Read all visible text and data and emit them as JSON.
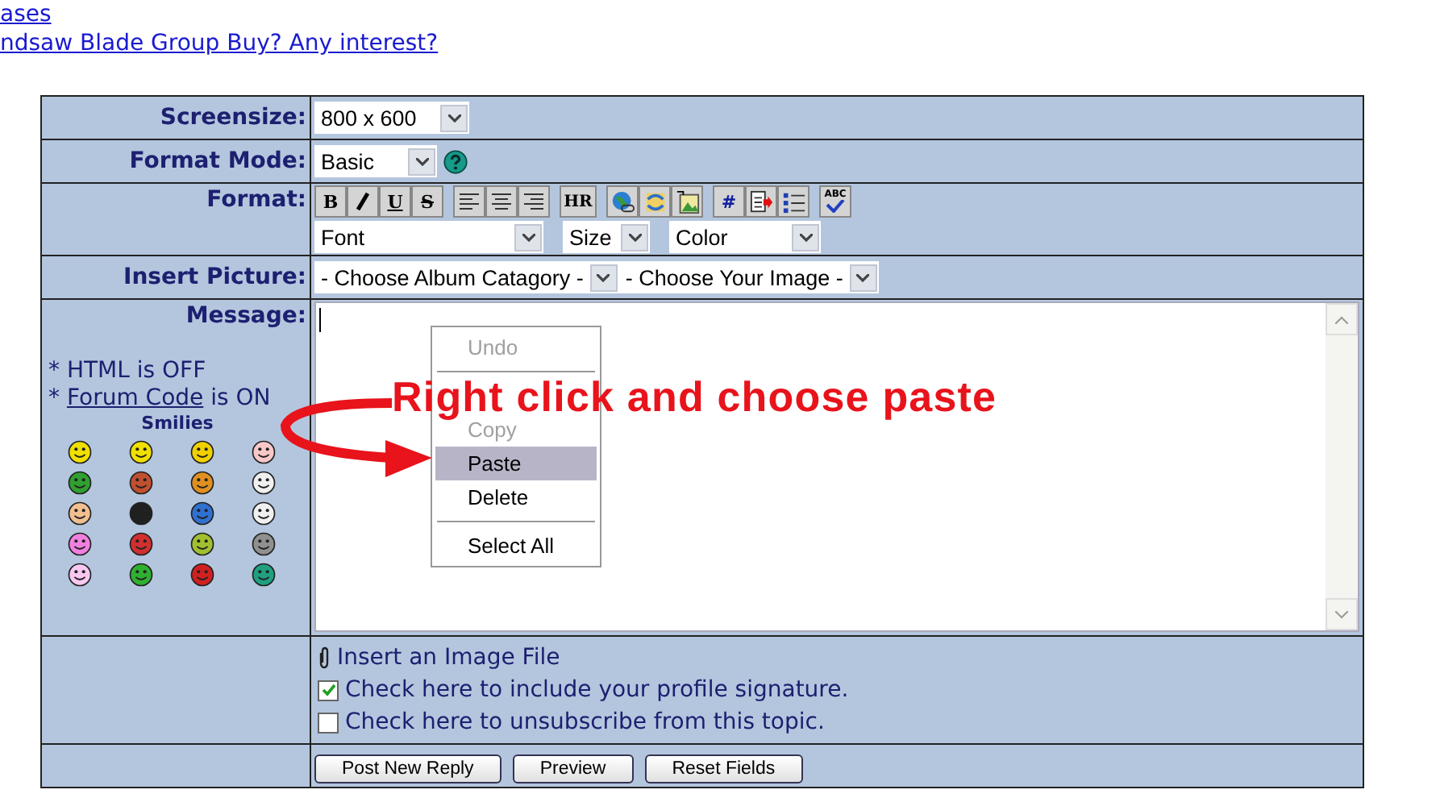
{
  "top_links": [
    "ases",
    "ndsaw Blade Group Buy? Any interest?"
  ],
  "screensize": {
    "label": "Screensize:",
    "value": "800 x 600"
  },
  "format_mode": {
    "label": "Format Mode:",
    "value": "Basic"
  },
  "format": {
    "label": "Format:",
    "toolbar": [
      [
        {
          "kind": "bold",
          "label": "B"
        },
        {
          "kind": "italic"
        },
        {
          "kind": "underline",
          "label": "U"
        },
        {
          "kind": "strike",
          "label": "S"
        }
      ],
      [
        {
          "kind": "align-left"
        },
        {
          "kind": "align-center"
        },
        {
          "kind": "align-right"
        }
      ],
      [
        {
          "kind": "bold",
          "label": "HR"
        }
      ],
      [
        {
          "kind": "globe"
        },
        {
          "kind": "swap"
        },
        {
          "kind": "image"
        }
      ],
      [
        {
          "kind": "hash",
          "label": "#"
        },
        {
          "kind": "doc-arrow"
        },
        {
          "kind": "list"
        }
      ],
      [
        {
          "kind": "spellcheck",
          "label": "ABC"
        }
      ]
    ],
    "selects": [
      {
        "value": "Font"
      },
      {
        "value": "Size"
      },
      {
        "value": "Color"
      }
    ]
  },
  "insert_picture": {
    "label": "Insert Picture:",
    "selects": [
      {
        "value": "- Choose Album Catagory -"
      },
      {
        "value": "- Choose Your Image -"
      }
    ]
  },
  "message": {
    "label": "Message:",
    "html_note": "* HTML is OFF",
    "code_note": {
      "prefix": "* ",
      "link": "Forum Code",
      "suffix": " is ON"
    },
    "smilies_title": "Smilies",
    "smilies": [
      {
        "color": "#f0e000"
      },
      {
        "color": "#f0e000"
      },
      {
        "color": "#f0d000"
      },
      {
        "color": "#f8c8c8"
      },
      {
        "color": "#30a030"
      },
      {
        "color": "#c05030"
      },
      {
        "color": "#e09020"
      },
      {
        "color": "#f0f0f0"
      },
      {
        "color": "#f0c090"
      },
      {
        "color": "#202020"
      },
      {
        "color": "#3070d0"
      },
      {
        "color": "#f0f0f0"
      },
      {
        "color": "#f080e0"
      },
      {
        "color": "#d03030"
      },
      {
        "color": "#a0c030"
      },
      {
        "color": "#909090"
      },
      {
        "color": "#f8c8f0"
      },
      {
        "color": "#30b030"
      },
      {
        "color": "#d02020"
      },
      {
        "color": "#20a080"
      }
    ]
  },
  "context_menu": [
    {
      "kind": "item",
      "label": "Undo",
      "disabled": true,
      "selected": false
    },
    {
      "kind": "separator"
    },
    {
      "kind": "item",
      "label": "Copy",
      "disabled": true,
      "selected": false
    },
    {
      "kind": "item",
      "label": "Paste",
      "disabled": false,
      "selected": true
    },
    {
      "kind": "item",
      "label": "Delete",
      "disabled": false,
      "selected": false
    },
    {
      "kind": "separator"
    },
    {
      "kind": "item",
      "label": "Select All",
      "disabled": false,
      "selected": false
    }
  ],
  "annotation": "Right click and choose paste",
  "attach": "Insert an Image File",
  "options": [
    {
      "label": "Check here to include your profile signature.",
      "checked": true
    },
    {
      "label": "Check here to unsubscribe from this topic.",
      "checked": false
    }
  ],
  "buttons": [
    "Post New Reply",
    "Preview",
    "Reset Fields"
  ]
}
